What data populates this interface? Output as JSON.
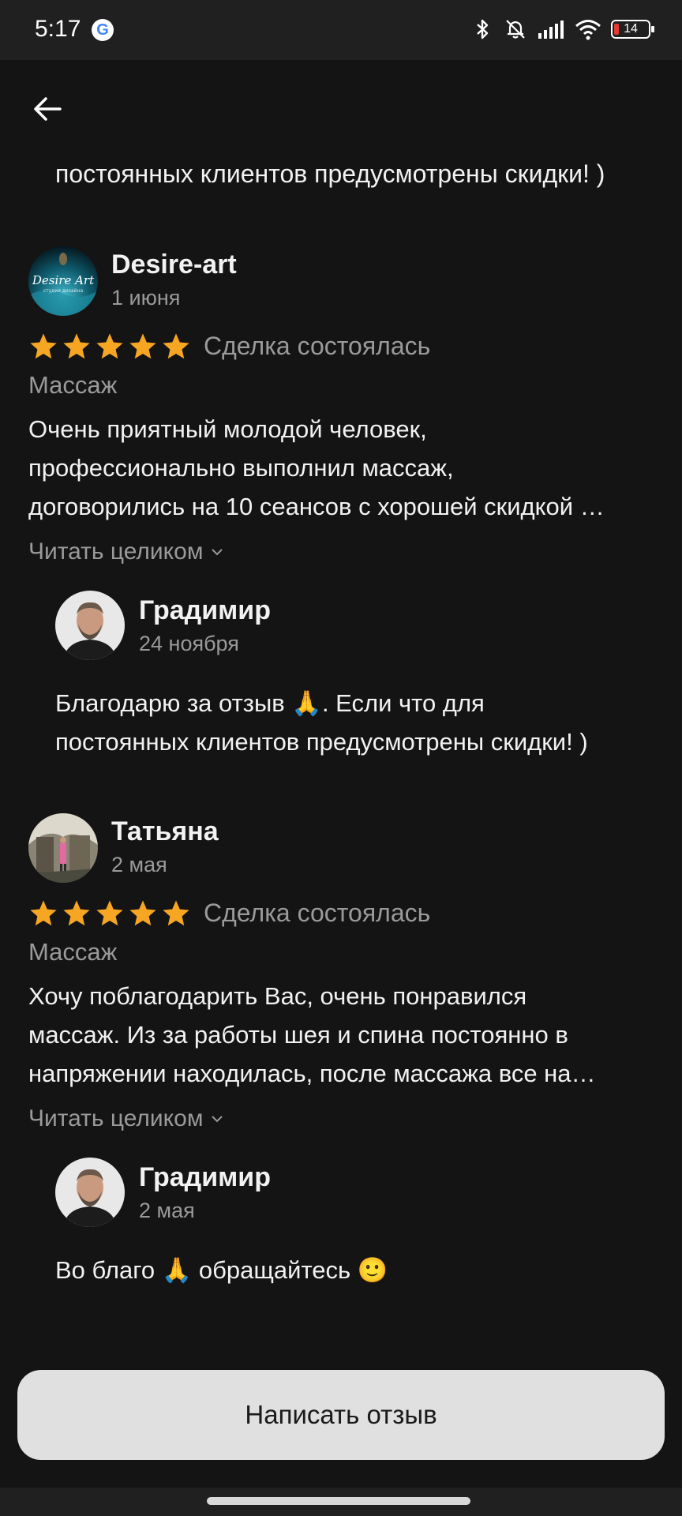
{
  "status_bar": {
    "time": "5:17",
    "battery": "14",
    "icons": [
      "google-icon",
      "bluetooth-icon",
      "bell-off-icon",
      "signal-icon",
      "wifi-icon",
      "battery-icon"
    ]
  },
  "colors": {
    "background": "#141414",
    "star": "#f6a623",
    "muted_text": "#9a9a9a",
    "button_bg": "#e0e0e0"
  },
  "top_partial_reply": {
    "text": "постоянных клиентов предусмотрены скидки! )"
  },
  "reviews": [
    {
      "author": "Desire-art",
      "date": "1 июня",
      "rating": 5,
      "status": "Сделка состоялась",
      "service": "Массаж",
      "text_lines": [
        "Очень приятный молодой человек,",
        "профессионально выполнил массаж,",
        "договорились на 10 сеансов с хорошей скидкой …"
      ],
      "read_more": "Читать целиком",
      "reply": {
        "author": "Градимир",
        "date": "24 ноября",
        "text_lines": [
          "Благодарю за отзыв 🙏. Если что для",
          "постоянных клиентов предусмотрены скидки! )"
        ]
      }
    },
    {
      "author": "Татьяна",
      "date": "2 мая",
      "rating": 5,
      "status": "Сделка состоялась",
      "service": "Массаж",
      "text_lines": [
        "Хочу поблагодарить Вас, очень понравился",
        "массаж. Из за  работы шея и спина постоянно в",
        "напряжении находилась, после массажа все на…"
      ],
      "read_more": "Читать целиком",
      "reply": {
        "author": "Градимир",
        "date": "2 мая",
        "text_lines": [
          "Во благо 🙏 обращайтесь 🙂"
        ]
      }
    }
  ],
  "avatar_logo_text": {
    "line1": "Desire Art",
    "line2": "студия дизайна"
  },
  "write_review_button": "Написать отзыв"
}
